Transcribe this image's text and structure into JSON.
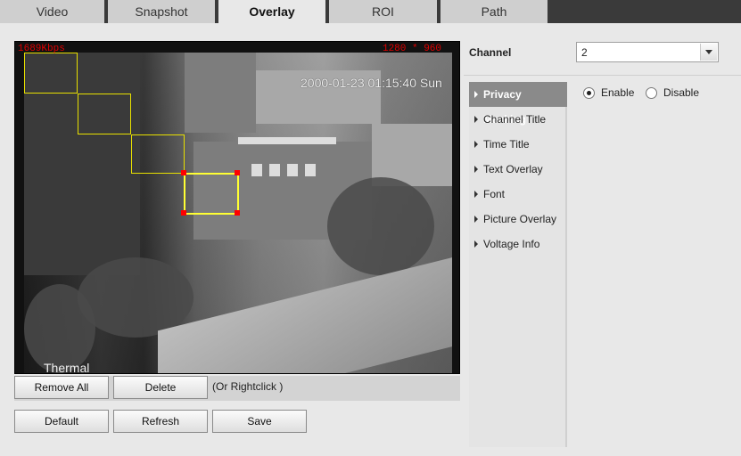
{
  "tabs": [
    {
      "label": "Video",
      "active": false
    },
    {
      "label": "Snapshot",
      "active": false
    },
    {
      "label": "Overlay",
      "active": true
    },
    {
      "label": "ROI",
      "active": false
    },
    {
      "label": "Path",
      "active": false
    }
  ],
  "video": {
    "bitrate": "1689Kbps",
    "resolution": "1280 * 960",
    "timestamp": "2000-01-23 01:15:40 Sun",
    "channel_title": "Thermal"
  },
  "buttons": {
    "remove_all": "Remove All",
    "delete": "Delete",
    "hint": "(Or Rightclick )",
    "default": "Default",
    "refresh": "Refresh",
    "save": "Save"
  },
  "channel": {
    "label": "Channel",
    "value": "2"
  },
  "menu": [
    {
      "label": "Privacy Masking",
      "active": true
    },
    {
      "label": "Channel Title",
      "active": false
    },
    {
      "label": "Time Title",
      "active": false
    },
    {
      "label": "Text Overlay",
      "active": false
    },
    {
      "label": "Font",
      "active": false
    },
    {
      "label": "Picture Overlay",
      "active": false
    },
    {
      "label": "Voltage Info",
      "active": false
    }
  ],
  "privacy": {
    "enable_label": "Enable",
    "disable_label": "Disable",
    "enabled": true
  },
  "colors": {
    "osd_red": "#e00000",
    "mask_yellow": "#e8e000",
    "handle_red": "#ff0000",
    "menu_active": "#8a8a8a"
  }
}
